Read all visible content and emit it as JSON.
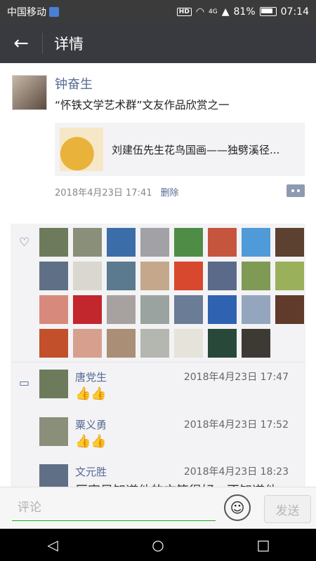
{
  "status": {
    "carrier": "中国移动",
    "network": "4G",
    "hd": "HD",
    "battery": "81%",
    "time": "07:14"
  },
  "header": {
    "title": "详情"
  },
  "post": {
    "author": "钟奋生",
    "text": "“怀铁文学艺术群”文友作品欣赏之一",
    "link_title": "刘建伍先生花鸟国画——独劈溪径...",
    "timestamp": "2018年4月23日 17:41",
    "delete_label": "删除"
  },
  "likes": {
    "avatar_colors": [
      "#6d7b5c",
      "#8a8f7a",
      "#3b6ea8",
      "#a2a2a6",
      "#4f8d47",
      "#c6553e",
      "#4f9bd9",
      "#5c4030",
      "#5f6f86",
      "#d9d7cf",
      "#5b7a8f",
      "#c5a88c",
      "#d8482e",
      "#5b6a89",
      "#7f9a55",
      "#9bb05a",
      "#d78a7c",
      "#c2272d",
      "#a7a2a0",
      "#9aa3a0",
      "#6b7c97",
      "#2f63b2",
      "#94a6bd",
      "#603a2a",
      "#c2502a",
      "#d7a08e",
      "#aa8f76",
      "#b4b7b0",
      "#e6e3da",
      "#28483a",
      "#3d3a36"
    ]
  },
  "comments": [
    {
      "name": "唐党生",
      "time": "2018年4月23日 17:47",
      "text": "👍👍",
      "avatar_color": "#6d7b5c"
    },
    {
      "name": "粟义勇",
      "time": "2018年4月23日 17:52",
      "text": "👍👍",
      "avatar_color": "#8a8f7a"
    },
    {
      "name": "文元胜",
      "time": "2018年4月23日 18:23",
      "text": "厉害另知道他的文笔很好，不知道他",
      "avatar_color": "#5f6f86"
    }
  ],
  "composer": {
    "placeholder": "评论",
    "send_label": "发送"
  },
  "colors": {
    "accent_link": "#576b95",
    "titlebar": "#393a3f",
    "input_underline": "#1aad19"
  }
}
